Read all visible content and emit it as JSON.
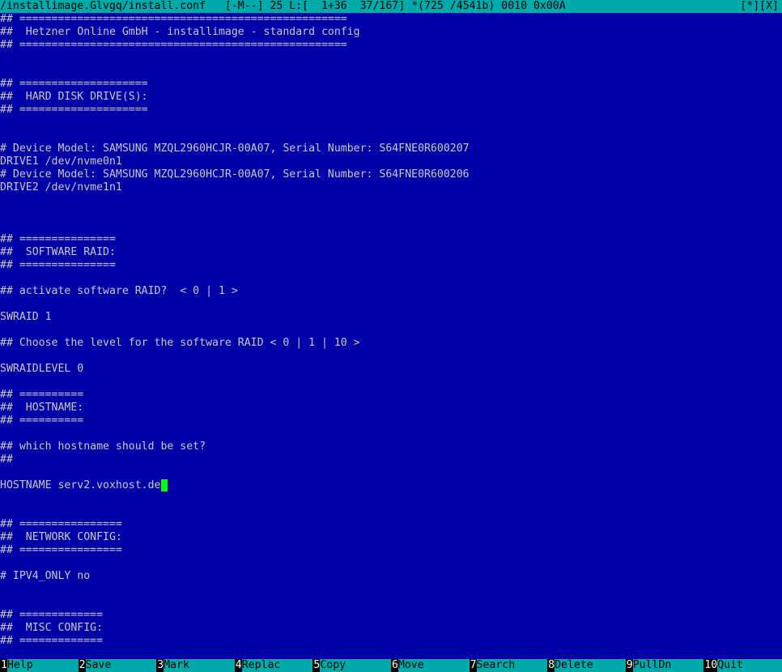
{
  "titlebar": {
    "left": "/installimage.Glvgq/install.conf   [-M--] 25 L:[  1+36  37/167] *(725 /4541b) 0010 0x00A",
    "right": "[*][X]"
  },
  "lines": [
    "## ===================================================",
    "##  Hetzner Online GmbH - installimage - standard config",
    "## ===================================================",
    "",
    "",
    "## ====================",
    "##  HARD DISK DRIVE(S):",
    "## ====================",
    "",
    "",
    "# Device Model: SAMSUNG MZQL2960HCJR-00A07, Serial Number: S64FNE0R600207",
    "DRIVE1 /dev/nvme0n1",
    "# Device Model: SAMSUNG MZQL2960HCJR-00A07, Serial Number: S64FNE0R600206",
    "DRIVE2 /dev/nvme1n1",
    "",
    "",
    "",
    "## ===============",
    "##  SOFTWARE RAID:",
    "## ===============",
    "",
    "## activate software RAID?  < 0 | 1 >",
    "",
    "SWRAID 1",
    "",
    "## Choose the level for the software RAID < 0 | 1 | 10 >",
    "",
    "SWRAIDLEVEL 0",
    "",
    "## ==========",
    "##  HOSTNAME:",
    "## ==========",
    "",
    "## which hostname should be set?",
    "##",
    "",
    "HOSTNAME serv2.voxhost.de",
    "",
    "",
    "## ================",
    "##  NETWORK CONFIG:",
    "## ================",
    "",
    "# IPV4_ONLY no",
    "",
    "",
    "## =============",
    "##  MISC CONFIG:",
    "## ============="
  ],
  "fkeys": [
    {
      "num": "1",
      "label": "Help"
    },
    {
      "num": "2",
      "label": "Save"
    },
    {
      "num": "3",
      "label": "Mark"
    },
    {
      "num": "4",
      "label": "Replac"
    },
    {
      "num": "5",
      "label": "Copy"
    },
    {
      "num": "6",
      "label": "Move"
    },
    {
      "num": "7",
      "label": "Search"
    },
    {
      "num": "8",
      "label": "Delete"
    },
    {
      "num": "9",
      "label": "PullDn"
    },
    {
      "num": "10",
      "label": "Quit"
    }
  ]
}
